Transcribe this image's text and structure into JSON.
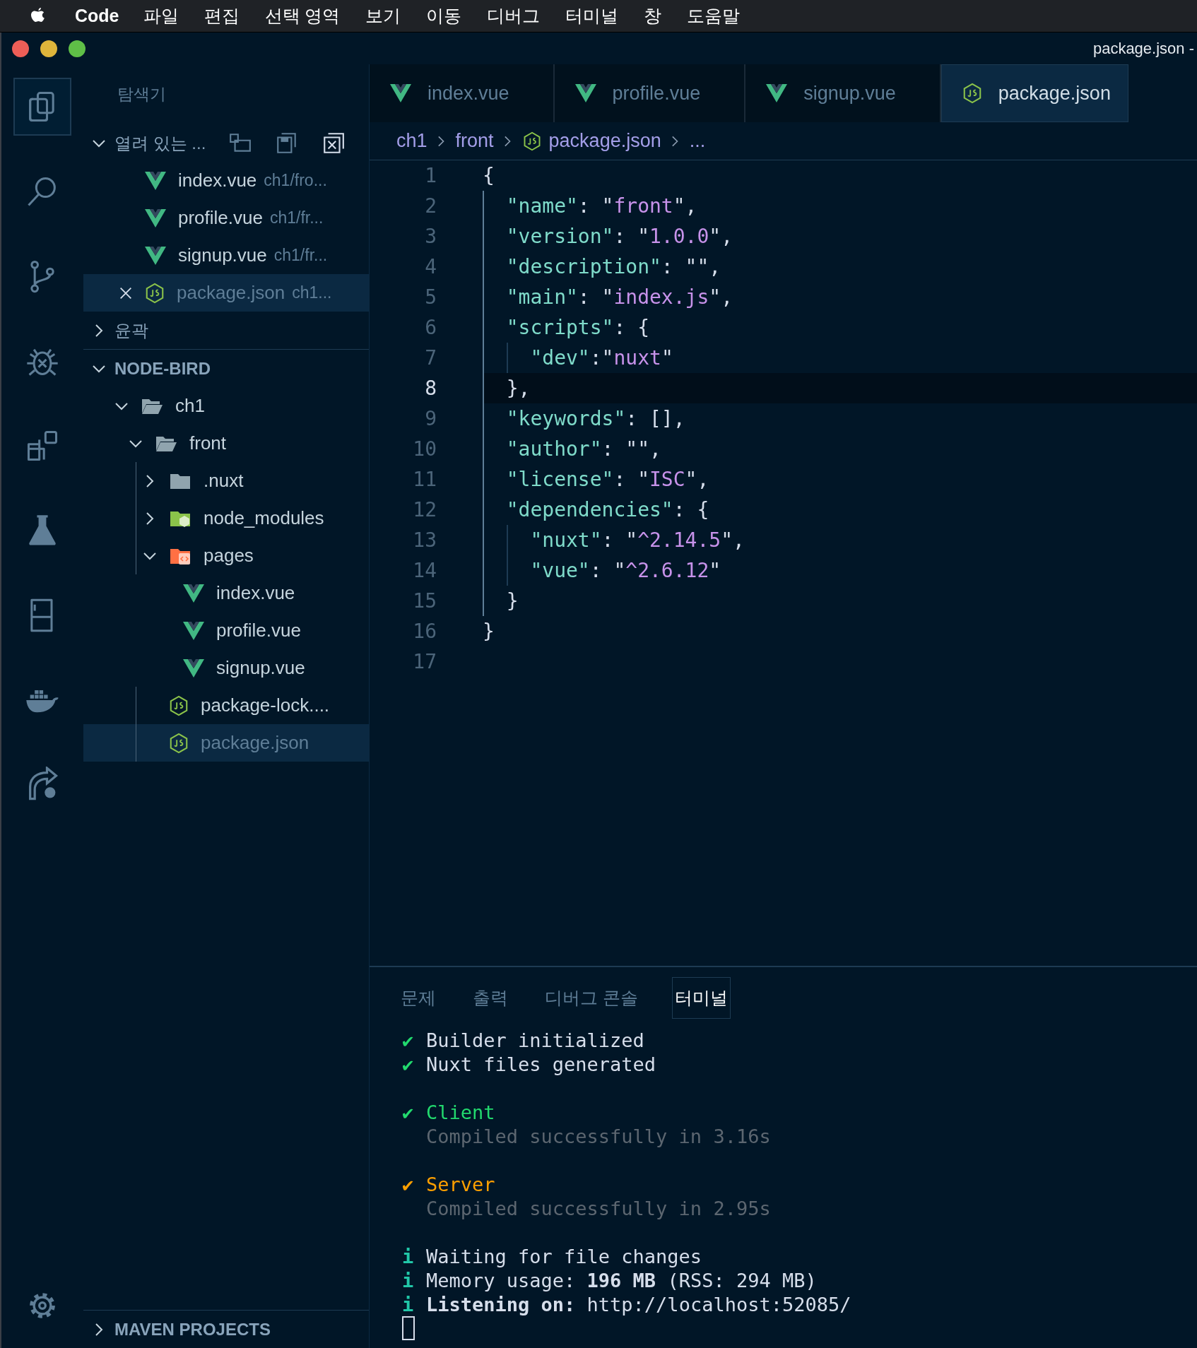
{
  "menubar": {
    "app": "Code",
    "items": [
      "파일",
      "편집",
      "선택 영역",
      "보기",
      "이동",
      "디버그",
      "터미널",
      "창",
      "도움말"
    ]
  },
  "window": {
    "title": "package.json -"
  },
  "activity_bar": {
    "items": [
      {
        "kind": "files",
        "selected": true
      },
      {
        "kind": "search",
        "selected": false
      },
      {
        "kind": "branch",
        "selected": false
      },
      {
        "kind": "bug",
        "selected": false
      },
      {
        "kind": "blocks",
        "selected": false
      },
      {
        "kind": "flask",
        "selected": false
      },
      {
        "kind": "panel",
        "selected": false
      },
      {
        "kind": "whale",
        "selected": false
      },
      {
        "kind": "share",
        "selected": false
      }
    ],
    "bottom": [
      {
        "kind": "gear",
        "selected": false
      }
    ]
  },
  "sidebar": {
    "title": "탐색기",
    "open_editors": {
      "label": "열려 있는 ...",
      "expanded": true,
      "items": [
        {
          "name": "index.vue",
          "path": "ch1/fro...",
          "kind": "vue",
          "selected": false
        },
        {
          "name": "profile.vue",
          "path": "ch1/fr...",
          "kind": "vue",
          "selected": false
        },
        {
          "name": "signup.vue",
          "path": "ch1/fr...",
          "kind": "vue",
          "selected": false
        },
        {
          "name": "package.json",
          "path": "ch1...",
          "kind": "json",
          "selected": true
        }
      ]
    },
    "outline": {
      "label": "윤곽",
      "expanded": false
    },
    "project": {
      "label": "NODE-BIRD",
      "expanded": true,
      "tree": [
        {
          "name": "ch1",
          "kind": "folder",
          "expanded": true,
          "selected": false,
          "children": [
            {
              "name": "front",
              "kind": "folder",
              "expanded": true,
              "selected": false,
              "children": [
                {
                  "name": ".nuxt",
                  "kind": "folder",
                  "expanded": false,
                  "selected": false
                },
                {
                  "name": "node_modules",
                  "kind": "node-folder",
                  "expanded": false,
                  "selected": false
                },
                {
                  "name": "pages",
                  "kind": "pages-folder",
                  "expanded": true,
                  "selected": false,
                  "children": [
                    {
                      "name": "index.vue",
                      "kind": "vue",
                      "selected": false
                    },
                    {
                      "name": "profile.vue",
                      "kind": "vue",
                      "selected": false
                    },
                    {
                      "name": "signup.vue",
                      "kind": "vue",
                      "selected": false
                    }
                  ]
                },
                {
                  "name": "package-lock....",
                  "kind": "json",
                  "selected": false
                },
                {
                  "name": "package.json",
                  "kind": "json",
                  "selected": true
                }
              ]
            }
          ]
        }
      ]
    },
    "maven": {
      "label": "MAVEN PROJECTS",
      "expanded": false
    }
  },
  "tabs": [
    {
      "label": "index.vue",
      "kind": "vue",
      "selected": false
    },
    {
      "label": "profile.vue",
      "kind": "vue",
      "selected": false
    },
    {
      "label": "signup.vue",
      "kind": "vue",
      "selected": false
    },
    {
      "label": "package.json",
      "kind": "json",
      "selected": true
    }
  ],
  "breadcrumb": [
    {
      "label": "ch1",
      "kind": "folder"
    },
    {
      "label": "front",
      "kind": "folder"
    },
    {
      "label": "package.json",
      "kind": "json"
    },
    {
      "label": "...",
      "kind": "more"
    }
  ],
  "editor": {
    "lines": [
      {
        "number": "1",
        "current": false,
        "tokens": [
          {
            "t": "{",
            "kind": "punct"
          }
        ],
        "children": [
          {
            "number": "2",
            "current": false,
            "tokens": [
              {
                "t": "\"name\"",
                "kind": "key"
              },
              {
                "t": ": \"",
                "kind": "punct"
              },
              {
                "t": "front",
                "kind": "string"
              },
              {
                "t": "\",",
                "kind": "punct"
              }
            ]
          },
          {
            "number": "3",
            "current": false,
            "tokens": [
              {
                "t": "\"version\"",
                "kind": "key"
              },
              {
                "t": ": \"",
                "kind": "punct"
              },
              {
                "t": "1.0.0",
                "kind": "string"
              },
              {
                "t": "\",",
                "kind": "punct"
              }
            ]
          },
          {
            "number": "4",
            "current": false,
            "tokens": [
              {
                "t": "\"description\"",
                "kind": "key"
              },
              {
                "t": ": \"\",",
                "kind": "punct"
              }
            ]
          },
          {
            "number": "5",
            "current": false,
            "tokens": [
              {
                "t": "\"main\"",
                "kind": "key"
              },
              {
                "t": ": \"",
                "kind": "punct"
              },
              {
                "t": "index.js",
                "kind": "string"
              },
              {
                "t": "\",",
                "kind": "punct"
              }
            ]
          },
          {
            "number": "6",
            "current": false,
            "tokens": [
              {
                "t": "\"scripts\"",
                "kind": "key"
              },
              {
                "t": ": {",
                "kind": "punct"
              }
            ],
            "children": [
              {
                "number": "7",
                "current": false,
                "tokens": [
                  {
                    "t": "\"dev\"",
                    "kind": "key"
                  },
                  {
                    "t": ":\"",
                    "kind": "punct"
                  },
                  {
                    "t": "nuxt",
                    "kind": "string"
                  },
                  {
                    "t": "\"",
                    "kind": "punct"
                  }
                ]
              }
            ]
          },
          {
            "number": "8",
            "current": true,
            "tokens": [
              {
                "t": "},",
                "kind": "punct"
              }
            ]
          },
          {
            "number": "9",
            "current": false,
            "tokens": [
              {
                "t": "\"keywords\"",
                "kind": "key"
              },
              {
                "t": ": [],",
                "kind": "punct"
              }
            ]
          },
          {
            "number": "10",
            "current": false,
            "tokens": [
              {
                "t": "\"author\"",
                "kind": "key"
              },
              {
                "t": ": \"\",",
                "kind": "punct"
              }
            ]
          },
          {
            "number": "11",
            "current": false,
            "tokens": [
              {
                "t": "\"license\"",
                "kind": "key"
              },
              {
                "t": ": \"",
                "kind": "punct"
              },
              {
                "t": "ISC",
                "kind": "string"
              },
              {
                "t": "\",",
                "kind": "punct"
              }
            ]
          },
          {
            "number": "12",
            "current": false,
            "tokens": [
              {
                "t": "\"dependencies\"",
                "kind": "key"
              },
              {
                "t": ": {",
                "kind": "punct"
              }
            ],
            "children": [
              {
                "number": "13",
                "current": false,
                "tokens": [
                  {
                    "t": "\"nuxt\"",
                    "kind": "key"
                  },
                  {
                    "t": ": \"",
                    "kind": "punct"
                  },
                  {
                    "t": "^2.14.5",
                    "kind": "string"
                  },
                  {
                    "t": "\",",
                    "kind": "punct"
                  }
                ]
              },
              {
                "number": "14",
                "current": false,
                "tokens": [
                  {
                    "t": "\"vue\"",
                    "kind": "key"
                  },
                  {
                    "t": ": \"",
                    "kind": "punct"
                  },
                  {
                    "t": "^2.6.12",
                    "kind": "string"
                  },
                  {
                    "t": "\"",
                    "kind": "punct"
                  }
                ]
              }
            ]
          },
          {
            "number": "15",
            "current": false,
            "tokens": [
              {
                "t": "}",
                "kind": "punct"
              }
            ]
          }
        ]
      },
      {
        "number": "16",
        "current": false,
        "tokens": [
          {
            "t": "}",
            "kind": "punct"
          }
        ]
      },
      {
        "number": "17",
        "current": false
      }
    ]
  },
  "panel": {
    "tabs": [
      {
        "label": "문제",
        "selected": false
      },
      {
        "label": "출력",
        "selected": false
      },
      {
        "label": "디버그 콘솔",
        "selected": false
      },
      {
        "label": "터미널",
        "selected": true
      }
    ],
    "terminal": {
      "cursor": true,
      "lines": [
        {
          "kind": "check",
          "mark": "✔",
          "text": "Builder initialized"
        },
        {
          "kind": "check",
          "mark": "✔",
          "text": "Nuxt files generated"
        },
        {
          "kind": "blank"
        },
        {
          "kind": "client",
          "mark": "✔",
          "text": "Client"
        },
        {
          "kind": "detail",
          "text": "Compiled successfully in 3.16s"
        },
        {
          "kind": "blank"
        },
        {
          "kind": "server",
          "mark": "✔",
          "text": "Server"
        },
        {
          "kind": "detail",
          "text": "Compiled successfully in 2.95s"
        },
        {
          "kind": "blank"
        },
        {
          "kind": "info",
          "mark": "i",
          "text": "Waiting for file changes"
        },
        {
          "kind": "info",
          "mark": "i",
          "text": "Memory usage: **196 MB** (RSS: 294 MB)"
        },
        {
          "kind": "info",
          "mark": "i",
          "text": "**Listening on:** http://localhost:52085/"
        }
      ]
    }
  }
}
